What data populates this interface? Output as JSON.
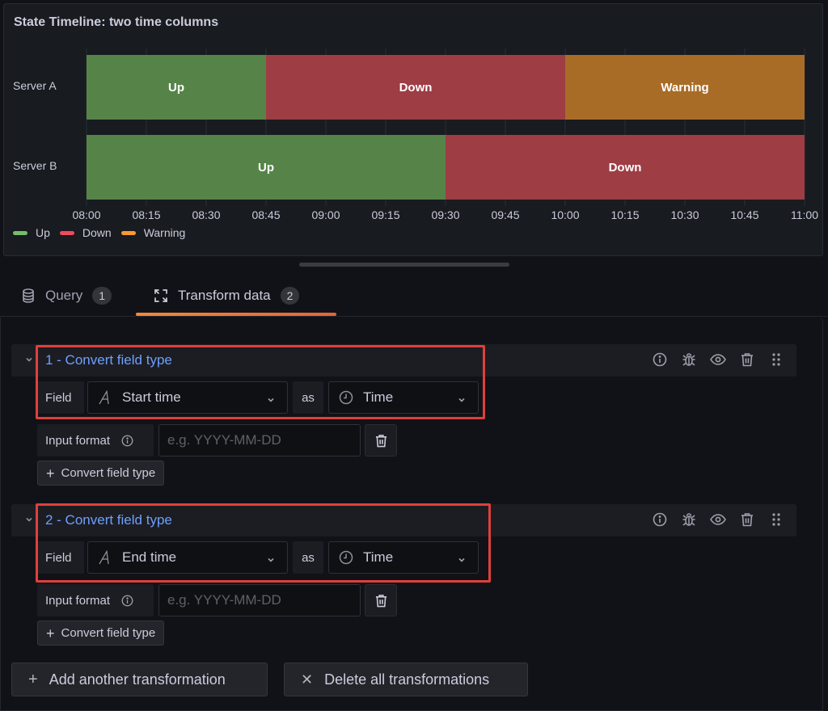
{
  "panel": {
    "title": "State Timeline: two time columns"
  },
  "chart_data": {
    "type": "state-timeline",
    "title": "State Timeline: two time columns",
    "x_axis": {
      "start": "08:00",
      "end": "11:00",
      "ticks": [
        "08:00",
        "08:15",
        "08:30",
        "08:45",
        "09:00",
        "09:15",
        "09:30",
        "09:45",
        "10:00",
        "10:15",
        "10:30",
        "10:45",
        "11:00"
      ]
    },
    "rows": [
      {
        "name": "Server A",
        "segments": [
          {
            "state": "Up",
            "start": "08:00",
            "end": "08:45"
          },
          {
            "state": "Down",
            "start": "08:45",
            "end": "10:00"
          },
          {
            "state": "Warning",
            "start": "10:00",
            "end": "11:00"
          }
        ]
      },
      {
        "name": "Server B",
        "segments": [
          {
            "state": "Up",
            "start": "08:00",
            "end": "09:30"
          },
          {
            "state": "Down",
            "start": "09:30",
            "end": "11:00"
          }
        ]
      }
    ],
    "states": {
      "Up": {
        "fill": "#5a8a4b",
        "legend": "#73bf69"
      },
      "Down": {
        "fill": "#a53f47",
        "legend": "#f2495c"
      },
      "Warning": {
        "fill": "#b07128",
        "legend": "#ff9830"
      }
    },
    "legend": {
      "placement": "bottom-left",
      "items": [
        "Up",
        "Down",
        "Warning"
      ]
    },
    "grid": true
  },
  "tabs": [
    {
      "label": "Query",
      "count": "1",
      "icon": "database-icon",
      "active": false
    },
    {
      "label": "Transform data",
      "count": "2",
      "icon": "transform-icon",
      "active": true
    }
  ],
  "transformations": [
    {
      "title": "1 - Convert field type",
      "field_label": "Field",
      "field_value": "Start time",
      "as_label": "as",
      "type_value": "Time",
      "input_format_label": "Input format",
      "input_format_value": "",
      "input_format_placeholder": "e.g. YYYY-MM-DD",
      "add_button": "Convert field type"
    },
    {
      "title": "2 - Convert field type",
      "field_label": "Field",
      "field_value": "End time",
      "as_label": "as",
      "type_value": "Time",
      "input_format_label": "Input format",
      "input_format_value": "",
      "input_format_placeholder": "e.g. YYYY-MM-DD",
      "add_button": "Convert field type"
    }
  ],
  "footer": {
    "add_label": "Add another transformation",
    "delete_label": "Delete all transformations"
  },
  "highlight_color": "#e0403a"
}
